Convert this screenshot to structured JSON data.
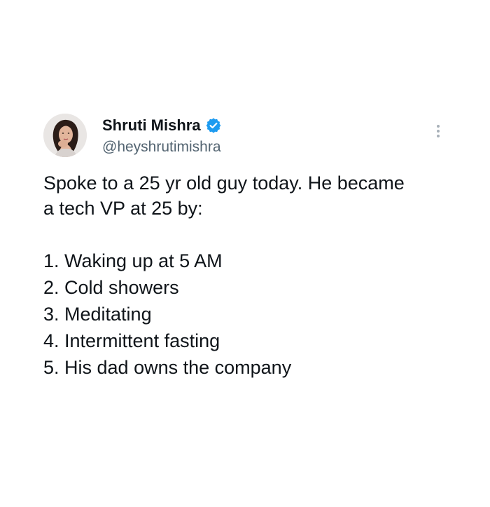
{
  "user": {
    "display_name": "Shruti Mishra",
    "handle": "@heyshrutimishra",
    "verified": true
  },
  "tweet": {
    "intro_line_1": "Spoke to a 25 yr old guy today. He became",
    "intro_line_2": "a tech VP at 25 by:",
    "items": [
      "1. Waking up at 5 AM",
      "2. Cold showers",
      "3. Meditating",
      "4. Intermittent fasting",
      "5. His dad owns the company"
    ]
  },
  "colors": {
    "text": "#0f1419",
    "secondary": "#536471",
    "verified_badge": "#1d9bf0",
    "background": "#ffffff"
  },
  "icons": {
    "verified": "verified-badge-icon",
    "more": "more-options-icon"
  }
}
